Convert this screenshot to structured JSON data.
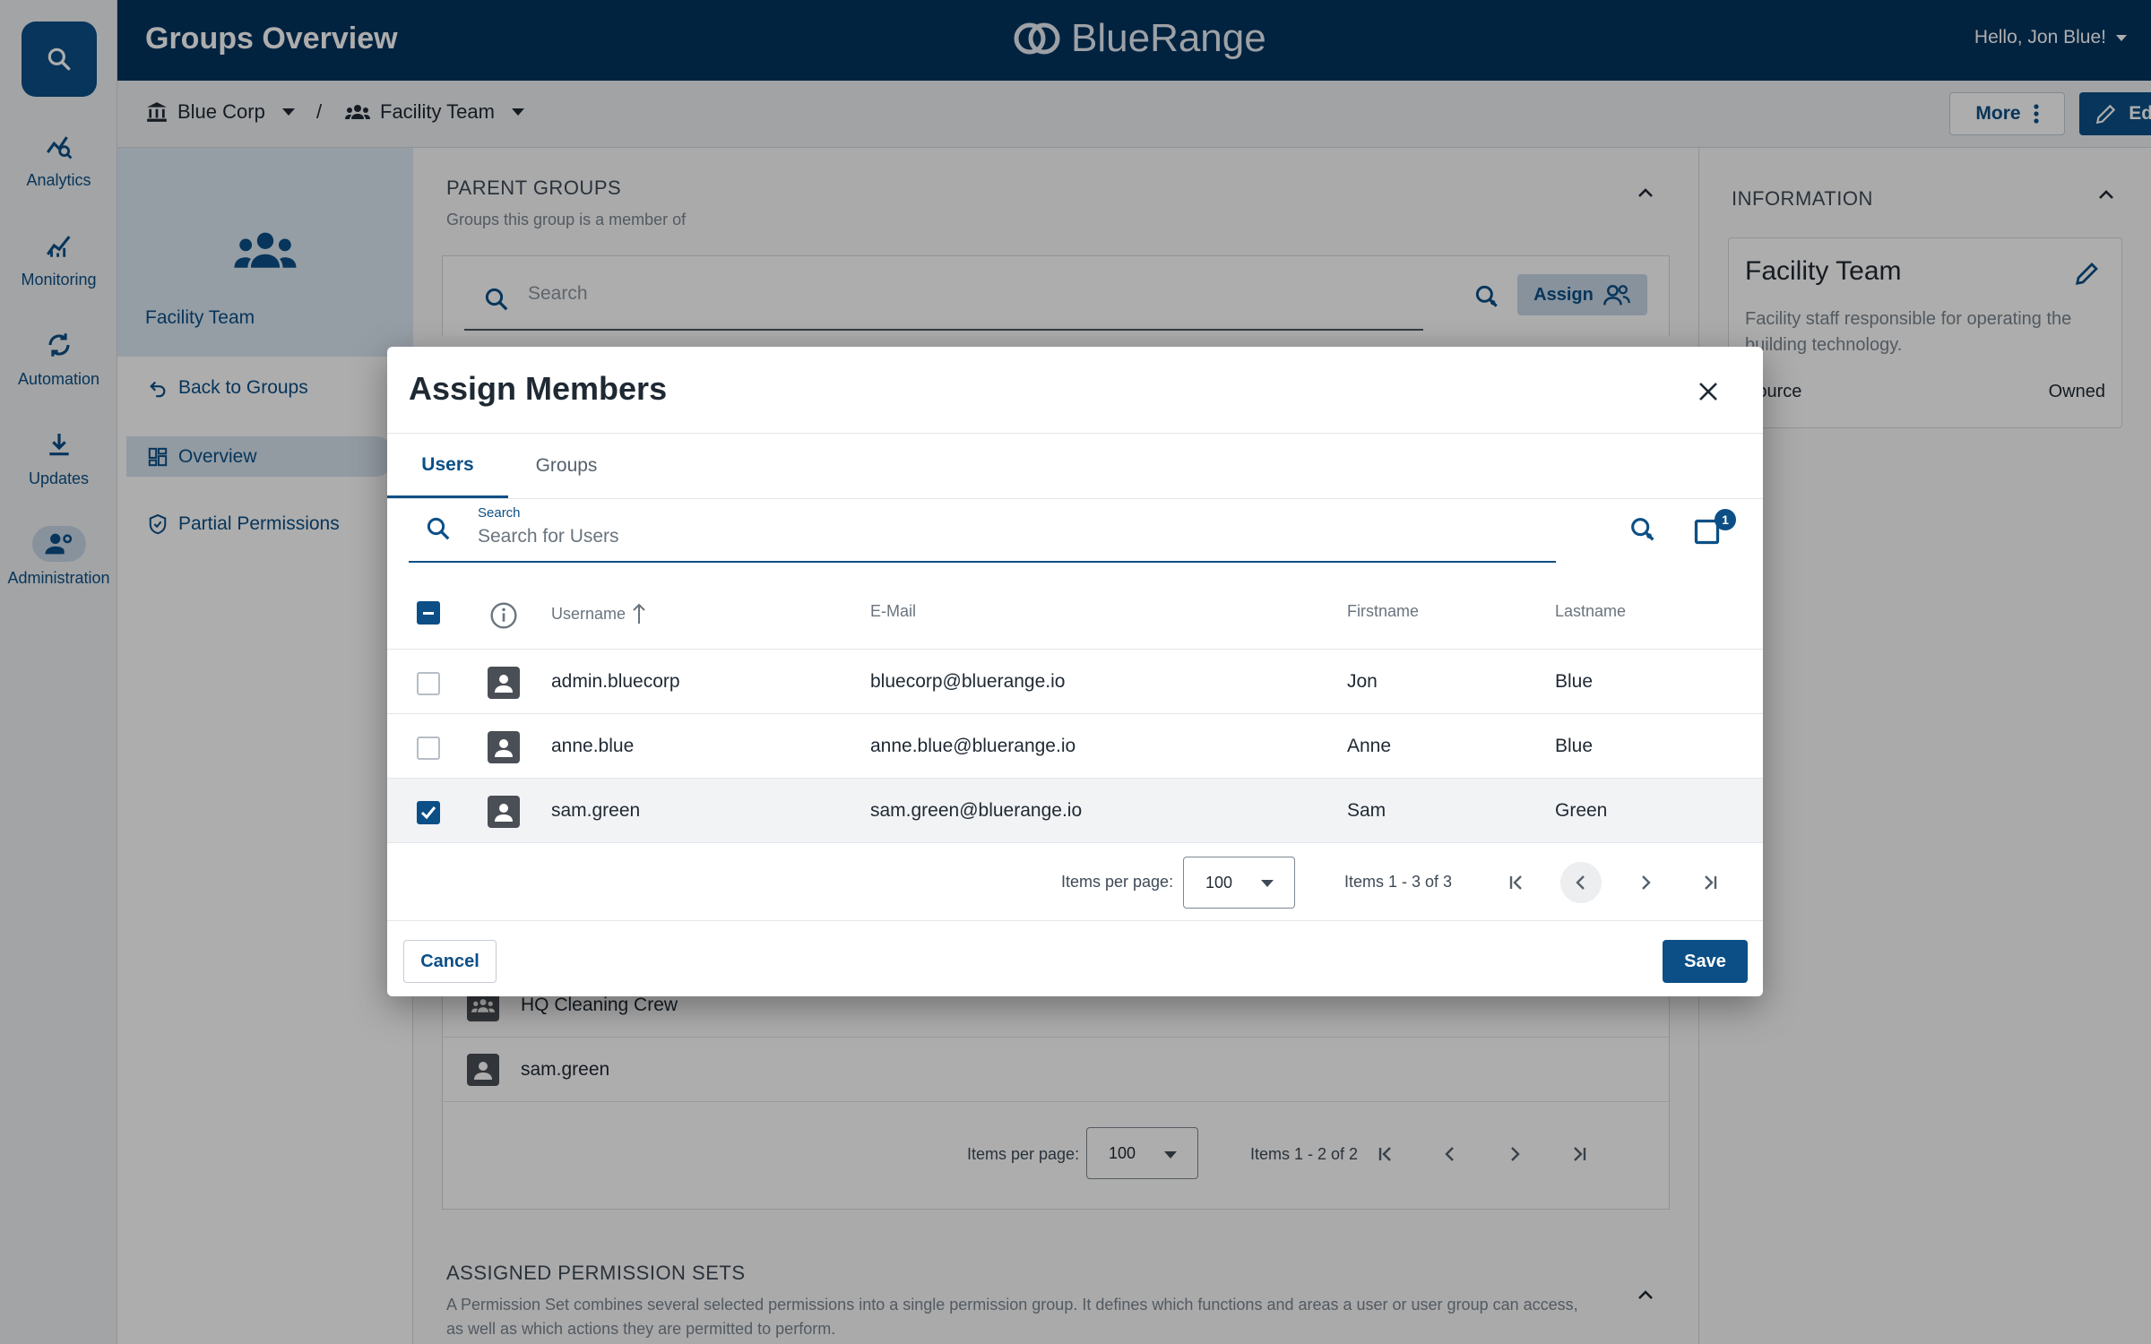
{
  "header": {
    "title": "Groups Overview",
    "brand": "BlueRange",
    "user_greeting": "Hello, Jon Blue!"
  },
  "rail": {
    "items": [
      {
        "label": "Analytics",
        "icon": "analytics-icon"
      },
      {
        "label": "Monitoring",
        "icon": "monitoring-icon"
      },
      {
        "label": "Automation",
        "icon": "automation-icon"
      },
      {
        "label": "Updates",
        "icon": "download-icon"
      },
      {
        "label": "Administration",
        "icon": "admin-icon",
        "active": true
      }
    ]
  },
  "breadcrumb": {
    "org": "Blue Corp",
    "separator": "/",
    "group": "Facility Team"
  },
  "toolbar": {
    "more_label": "More",
    "edit_label": "Edit Group"
  },
  "leftnav": {
    "group_name": "Facility Team",
    "links": [
      {
        "label": "Back to Groups",
        "icon": "back-icon"
      },
      {
        "label": "Overview",
        "icon": "dashboard-icon",
        "active": true
      },
      {
        "label": "Partial Permissions",
        "icon": "shield-icon"
      }
    ]
  },
  "parent_groups": {
    "title": "PARENT GROUPS",
    "subtitle": "Groups this group is a member of",
    "search_placeholder": "Search",
    "assign_label": "Assign"
  },
  "members": {
    "rows": [
      {
        "name": "HQ Cleaning Crew",
        "type": "group"
      },
      {
        "name": "sam.green",
        "type": "user"
      }
    ],
    "pagination": {
      "items_per_page_label": "Items per page:",
      "items_per_page": "100",
      "range": "Items 1 - 2 of 2"
    }
  },
  "permission_sets": {
    "title": "ASSIGNED PERMISSION SETS",
    "description": "A Permission Set combines several selected permissions into a single permission group. It defines which functions and areas a user or user group can access, as well as which actions they are permitted to perform."
  },
  "info": {
    "title": "INFORMATION",
    "name": "Facility Team",
    "description": "Facility staff responsible for operating the building technology.",
    "source_label": "Source",
    "source_value": "Owned"
  },
  "modal": {
    "title": "Assign Members",
    "tabs": [
      "Users",
      "Groups"
    ],
    "active_tab": "Users",
    "search": {
      "label": "Search",
      "placeholder": "Search for Users"
    },
    "selected_count": "1",
    "columns": {
      "username": "Username",
      "email": "E-Mail",
      "firstname": "Firstname",
      "lastname": "Lastname"
    },
    "sort": {
      "column": "username",
      "direction": "ascending"
    },
    "users": [
      {
        "username": "admin.bluecorp",
        "email": "bluecorp@bluerange.io",
        "firstname": "Jon",
        "lastname": "Blue",
        "selected": false
      },
      {
        "username": "anne.blue",
        "email": "anne.blue@bluerange.io",
        "firstname": "Anne",
        "lastname": "Blue",
        "selected": false
      },
      {
        "username": "sam.green",
        "email": "sam.green@bluerange.io",
        "firstname": "Sam",
        "lastname": "Green",
        "selected": true
      }
    ],
    "pagination": {
      "items_per_page_label": "Items per page:",
      "items_per_page": "100",
      "range": "Items 1 - 3 of 3"
    },
    "cancel_label": "Cancel",
    "save_label": "Save"
  },
  "colors": {
    "primary": "#0b4f86",
    "header": "#04345f",
    "accent_light": "#c7d8e8"
  }
}
